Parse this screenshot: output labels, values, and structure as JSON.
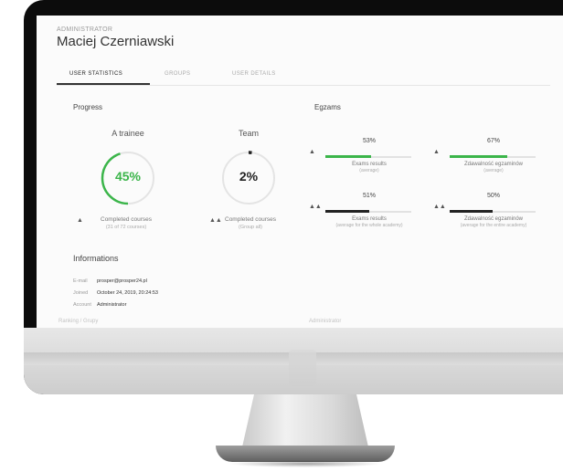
{
  "header": {
    "role": "ADMINISTRATOR",
    "user_name": "Maciej Czerniawski"
  },
  "tabs": [
    "USER STATISTICS",
    "GROUPS",
    "USER DETAILS"
  ],
  "progress": {
    "title": "Progress",
    "trainee": {
      "label": "A trainee",
      "value_text": "45%",
      "value": 45,
      "color": "#3bb54a",
      "caption": "Completed courses",
      "subcaption": "(31 of 72 courses)"
    },
    "team": {
      "label": "Team",
      "value_text": "2%",
      "value": 2,
      "color": "#222222",
      "caption": "Completed courses",
      "subcaption": "(Group all)"
    }
  },
  "exams": {
    "title": "Egzams",
    "items": [
      {
        "pct_text": "53%",
        "value": 53,
        "color": "#3bb54a",
        "caption": "Exams results",
        "subcaption": "(average)"
      },
      {
        "pct_text": "67%",
        "value": 67,
        "color": "#3bb54a",
        "caption": "Zdawalność egzaminów",
        "subcaption": "(average)"
      },
      {
        "pct_text": "51%",
        "value": 51,
        "color": "#222222",
        "caption": "Exams results",
        "subcaption": "(average for the whole academy)"
      },
      {
        "pct_text": "50%",
        "value": 50,
        "color": "#222222",
        "caption": "Zdawalność egzaminów",
        "subcaption": "(average for the entire academy)"
      }
    ]
  },
  "informations": {
    "title": "Informations",
    "rows": [
      {
        "label": "E-mail",
        "value": "prosper@prosper24.pl"
      },
      {
        "label": "Joined",
        "value": "October 24, 2019, 20:24:53"
      },
      {
        "label": "Account",
        "value": "Administrator"
      }
    ]
  },
  "footer": {
    "left_text": "Ranking / Grupy",
    "right_text": "Administrator"
  }
}
